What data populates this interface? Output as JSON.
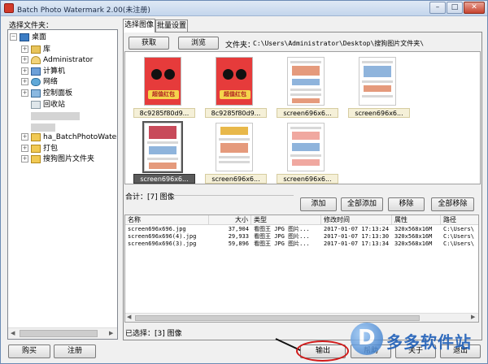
{
  "window": {
    "title": "Batch Photo Watermark 2.00(未注册)",
    "min_label": "–",
    "max_label": "□",
    "close_label": "✕"
  },
  "left": {
    "label": "选择文件夹：",
    "tree": [
      {
        "label": "桌面",
        "icon": "desktop-icon",
        "expander": "−"
      },
      {
        "label": "库",
        "icon": "library-icon",
        "expander": "+"
      },
      {
        "label": "Administrator",
        "icon": "user-folder-icon",
        "expander": "+"
      },
      {
        "label": "计算机",
        "icon": "computer-icon",
        "expander": "+"
      },
      {
        "label": "网络",
        "icon": "network-icon",
        "expander": "+"
      },
      {
        "label": "控制面板",
        "icon": "control-panel-icon",
        "expander": "+"
      },
      {
        "label": "回收站",
        "icon": "recycle-bin-icon",
        "expander": ""
      },
      {
        "label": "ha_BatchPhotoWaterMa",
        "icon": "folder-icon",
        "expander": "+"
      },
      {
        "label": "打包",
        "icon": "folder-icon",
        "expander": "+"
      },
      {
        "label": "搜狗图片文件夹",
        "icon": "folder-icon",
        "expander": "+"
      }
    ],
    "buy_label": "购买",
    "register_label": "注册"
  },
  "tabs": [
    "选择图像",
    "批量设置"
  ],
  "toolbar": {
    "get_label": "获取",
    "browse_label": "浏览",
    "folder_label": "文件夹：",
    "folder_path": "C:\\Users\\Administrator\\Desktop\\搜狗图片文件夹\\"
  },
  "thumbnails": [
    {
      "caption": "8c9285f80d9...",
      "kind": "red",
      "badge": "超值红包",
      "selected": false
    },
    {
      "caption": "8c9285f80d9...",
      "kind": "red",
      "badge": "超值红包",
      "selected": false
    },
    {
      "caption": "screen696x6...",
      "kind": "phone",
      "selected": false
    },
    {
      "caption": "screen696x6...",
      "kind": "phone",
      "selected": false
    },
    {
      "caption": "screen696x6...",
      "kind": "phone",
      "selected": true
    },
    {
      "caption": "screen696x6...",
      "kind": "phone",
      "selected": false
    },
    {
      "caption": "screen696x6...",
      "kind": "phone",
      "selected": false
    }
  ],
  "count_label": "合计：[7] 图像",
  "actions": {
    "add": "添加",
    "add_all": "全部添加",
    "remove": "移除",
    "remove_all": "全部移除"
  },
  "list": {
    "headers": [
      "名称",
      "大小",
      "类型",
      "修改时间",
      "属性",
      "路径"
    ],
    "rows": [
      [
        "screen696x696.jpg",
        "37,904",
        "看图王 JPG 图片...",
        "2017-01-07 17:13:24",
        "320x568x16M",
        "C:\\Users\\"
      ],
      [
        "screen696x696(4).jpg",
        "29,933",
        "看图王 JPG 图片...",
        "2017-01-07 17:13:30",
        "320x568x16M",
        "C:\\Users\\"
      ],
      [
        "screen696x696(3).jpg",
        "59,896",
        "看图王 JPG 图片...",
        "2017-01-07 17:13:34",
        "320x568x16M",
        "C:\\Users\\"
      ]
    ]
  },
  "selected_label": "已选择：[3] 图像",
  "bottom": {
    "output": "输出",
    "help": "帮助",
    "about": "关于",
    "exit": "退出"
  },
  "watermark_site": "多多软件站",
  "colors": {
    "highlight_ring": "#d11a1a",
    "selected_caption": "#5a5a5a"
  }
}
